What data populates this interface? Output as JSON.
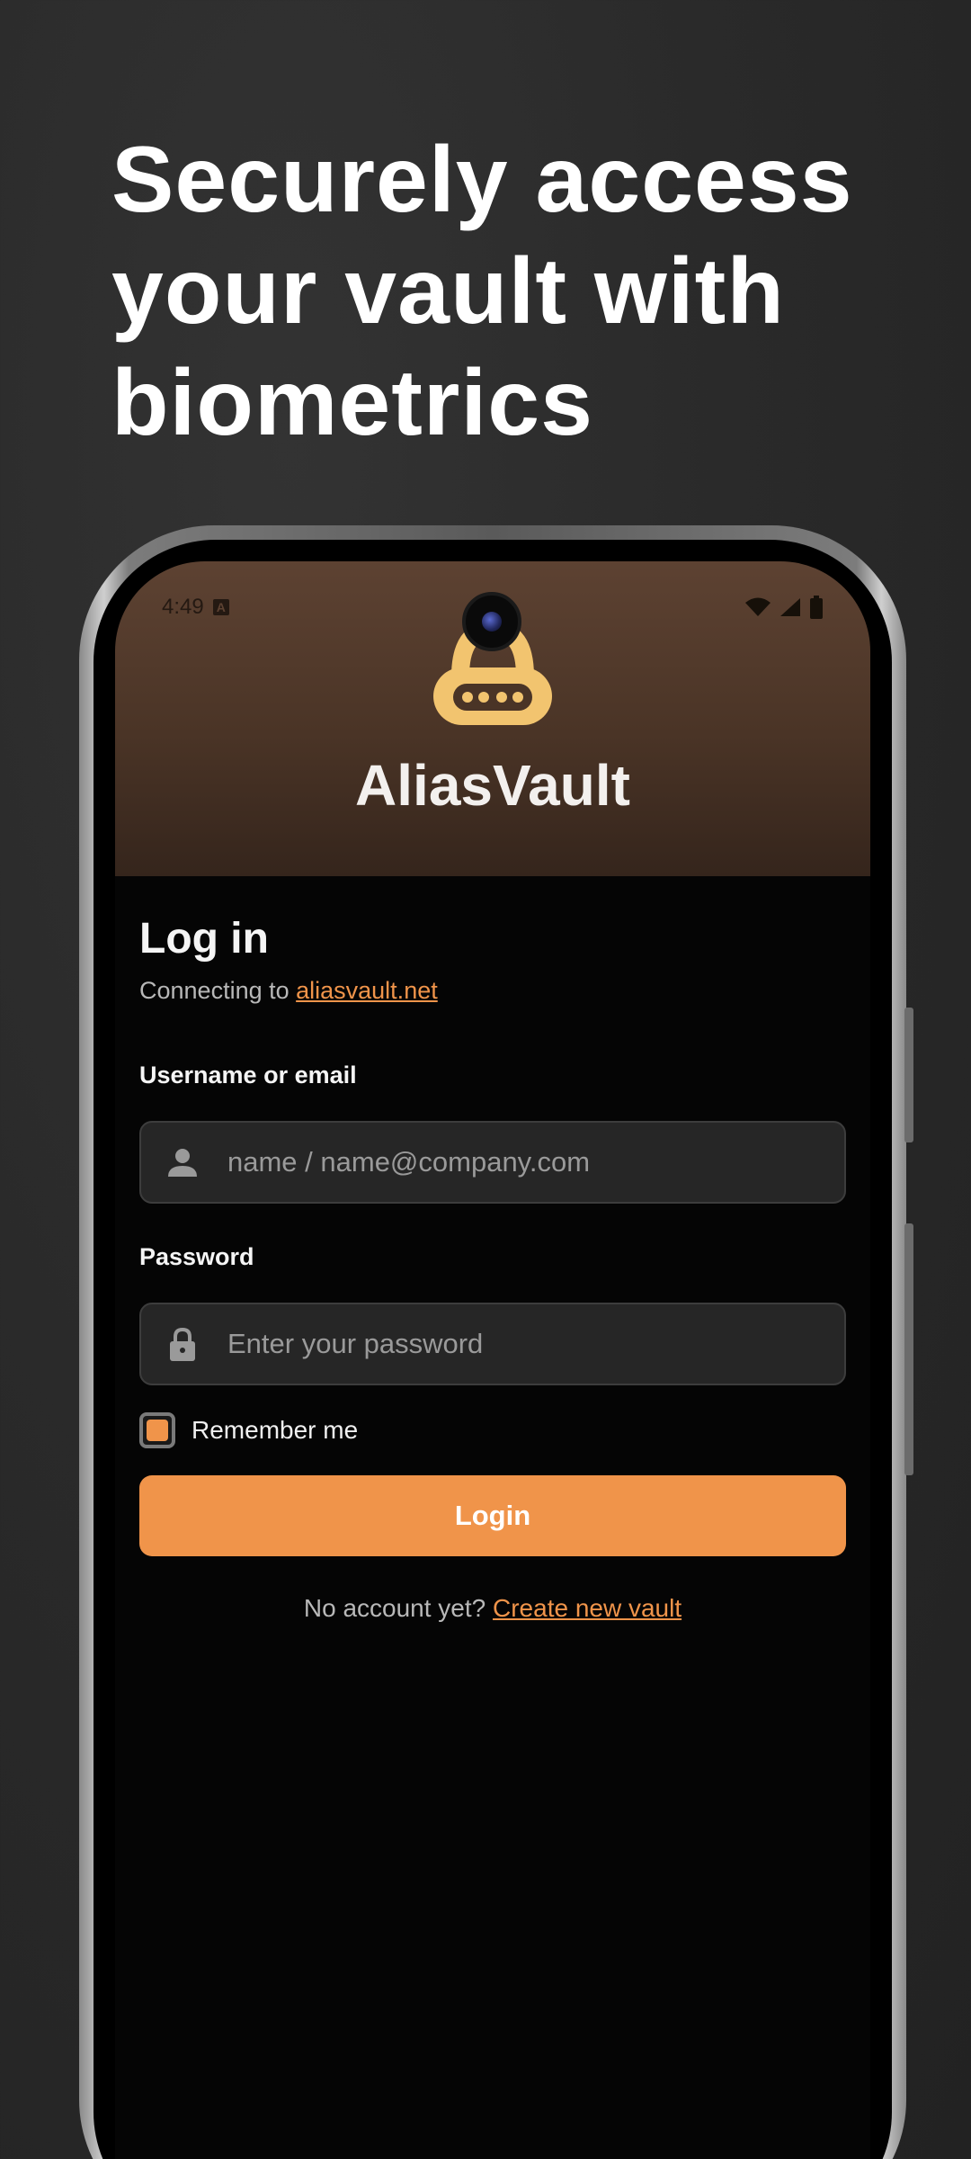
{
  "headline": "Securely access your vault with biometrics",
  "status_bar": {
    "time": "4:49",
    "icons": [
      "notification-a-icon",
      "wifi-icon",
      "signal-icon",
      "battery-icon"
    ]
  },
  "app": {
    "title": "AliasVault",
    "logo_icon": "padlock-password-icon"
  },
  "login": {
    "title": "Log in",
    "connecting_prefix": "Connecting to ",
    "server_link": "aliasvault.net",
    "username_label": "Username or email",
    "username_placeholder": "name / name@company.com",
    "username_value": "",
    "password_label": "Password",
    "password_placeholder": "Enter your password",
    "password_value": "",
    "remember_label": "Remember me",
    "remember_checked": true,
    "login_button": "Login",
    "signup_prefix": "No account yet? ",
    "signup_link": "Create new vault"
  },
  "colors": {
    "accent": "#f0944a",
    "header_top": "#5d4232",
    "header_bottom": "#35251c",
    "screen_bg": "#050505",
    "input_bg": "#262626",
    "logo": "#f2c46f"
  }
}
